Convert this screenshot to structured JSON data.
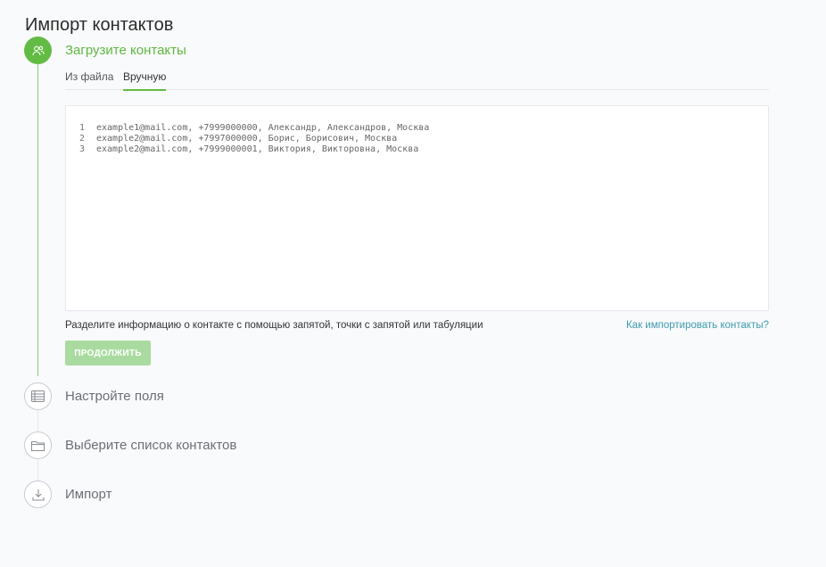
{
  "page": {
    "title": "Импорт контактов"
  },
  "steps": [
    {
      "label": "Загрузите контакты",
      "icon": "users-icon",
      "state": "active"
    },
    {
      "label": "Настройте поля",
      "icon": "table-icon",
      "state": "pending"
    },
    {
      "label": "Выберите список контактов",
      "icon": "folder-icon",
      "state": "pending"
    },
    {
      "label": "Импорт",
      "icon": "download-icon",
      "state": "pending"
    }
  ],
  "tabs": [
    {
      "label": "Из файла",
      "selected": false
    },
    {
      "label": "Вручную",
      "selected": true
    }
  ],
  "editor": {
    "lines": [
      {
        "number": "1",
        "text": "example1@mail.com, +7999000000, Александр, Александров, Москва"
      },
      {
        "number": "2",
        "text": "example2@mail.com, +7997000000, Борис, Борисович, Москва"
      },
      {
        "number": "3",
        "text": "example2@mail.com, +7999000001, Виктория, Викторовна, Москва"
      }
    ]
  },
  "hint": "Разделите информацию о контакте с помощью запятой, точки с запятой или табуляции",
  "help_link": "Как импортировать контакты?",
  "continue_button": "ПРОДОЛЖИТЬ",
  "colors": {
    "accent": "#62bc44",
    "button_disabled": "#a9dba0",
    "link": "#3c9bb0"
  }
}
